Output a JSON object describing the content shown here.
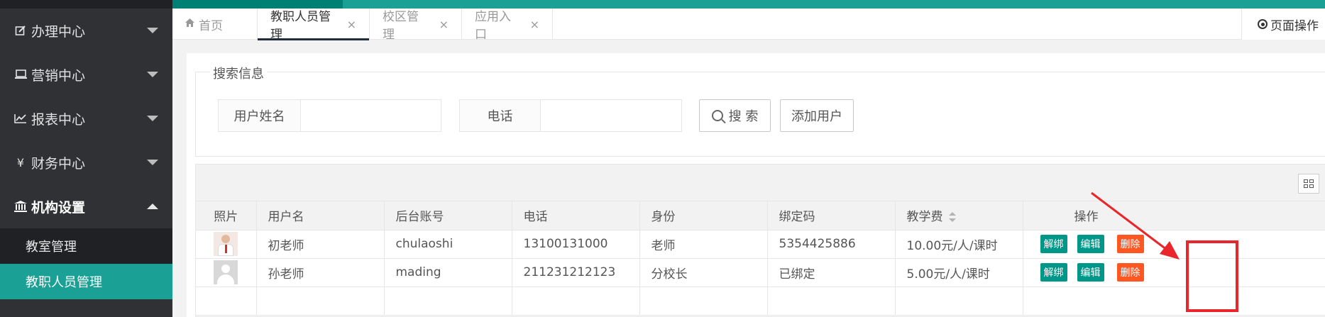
{
  "sidebar": {
    "items": [
      {
        "label": "办理中心",
        "icon": "edit-icon",
        "open": false
      },
      {
        "label": "营销中心",
        "icon": "laptop-icon",
        "open": false
      },
      {
        "label": "报表中心",
        "icon": "line-chart-icon",
        "open": false
      },
      {
        "label": "财务中心",
        "icon": "yen-icon",
        "open": false
      },
      {
        "label": "机构设置",
        "icon": "institution-icon",
        "open": true
      }
    ],
    "subitems": [
      {
        "label": "教室管理",
        "active": false
      },
      {
        "label": "教职人员管理",
        "active": true
      }
    ]
  },
  "tabs": [
    {
      "label": "首页",
      "icon": "home-icon",
      "closable": false,
      "active": false
    },
    {
      "label": "教职人员管理",
      "closable": true,
      "active": true
    },
    {
      "label": "校区管理",
      "closable": true,
      "active": false
    },
    {
      "label": "应用入口",
      "closable": true,
      "active": false
    }
  ],
  "tab_close_glyph": "×",
  "page_ops_label": "页面操作",
  "search": {
    "legend": "搜索信息",
    "name_label": "用户姓名",
    "name_value": "",
    "phone_label": "电话",
    "phone_value": "",
    "search_button": "搜 索",
    "add_button": "添加用户"
  },
  "table": {
    "headers": [
      "照片",
      "用户名",
      "后台账号",
      "电话",
      "身份",
      "绑定码",
      "教学费",
      "操作"
    ],
    "rows": [
      {
        "photo": "teacher-photo",
        "username": "初老师",
        "account": "chulaoshi",
        "phone": "13100131000",
        "role": "老师",
        "bind_code": "5354425886",
        "fee": "10.00元/人/课时"
      },
      {
        "photo": "default-avatar",
        "username": "孙老师",
        "account": "mading",
        "phone": "211231212123",
        "role": "分校长",
        "bind_code": "已绑定",
        "fee": "5.00元/人/课时"
      }
    ],
    "actions": {
      "unbind": "解绑",
      "edit": "编辑",
      "delete": "删除"
    }
  },
  "colors": {
    "sidebar_bg": "#2f3135",
    "accent_teal": "#1aa094",
    "button_green": "#009688",
    "button_red": "#ff5722",
    "annotation_red": "#e8262b"
  }
}
